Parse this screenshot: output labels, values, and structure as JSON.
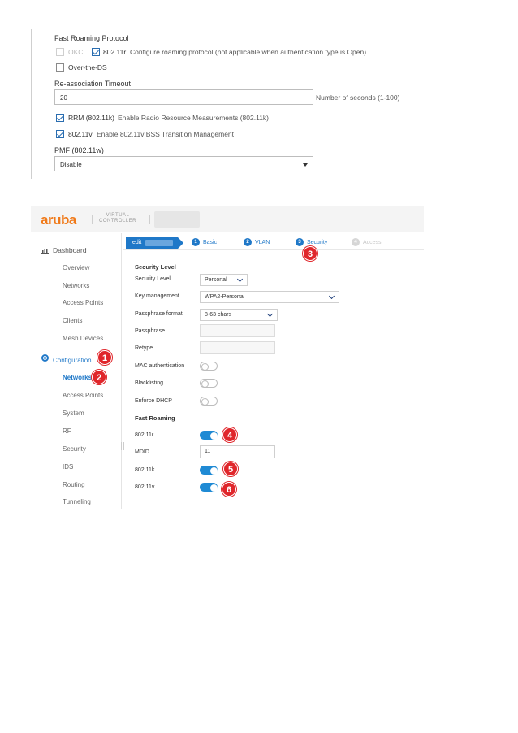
{
  "top_panel": {
    "fast_roaming_title": "Fast Roaming Protocol",
    "okc_label": "OKC",
    "r802_11r_label": "802.11r",
    "r802_11r_desc": "Configure roaming protocol (not applicable when authentication type is Open)",
    "over_the_ds_label": "Over-the-DS",
    "reassoc_title": "Re-association Timeout",
    "reassoc_value": "20",
    "reassoc_hint": "Number of seconds (1-100)",
    "rrm_label": "RRM (802.11k)",
    "rrm_desc": "Enable Radio Resource Measurements (802.11k)",
    "v802_11v_label": "802.11v",
    "v802_11v_desc": "Enable 802.11v BSS Transition Management",
    "pmf_title": "PMF (802.11w)",
    "pmf_value": "Disable"
  },
  "header": {
    "logo": "aruba",
    "product_line1": "VIRTUAL",
    "product_line2": "CONTROLLER"
  },
  "sidebar": {
    "dashboard": "Dashboard",
    "dashboard_items": [
      "Overview",
      "Networks",
      "Access Points",
      "Clients",
      "Mesh Devices"
    ],
    "configuration": "Configuration",
    "configuration_items": [
      "Networks",
      "Access Points",
      "System",
      "RF",
      "Security",
      "IDS",
      "Routing",
      "Tunneling"
    ]
  },
  "wizard": {
    "edit_label": "edit",
    "steps": [
      {
        "num": "1",
        "label": "Basic"
      },
      {
        "num": "2",
        "label": "VLAN"
      },
      {
        "num": "3",
        "label": "Security"
      },
      {
        "num": "4",
        "label": "Access"
      }
    ]
  },
  "form": {
    "security_level_head": "Security Level",
    "security_level_label": "Security Level",
    "security_level_value": "Personal",
    "key_mgmt_label": "Key management",
    "key_mgmt_value": "WPA2-Personal",
    "passphrase_format_label": "Passphrase format",
    "passphrase_format_value": "8-63 chars",
    "passphrase_label": "Passphrase",
    "retype_label": "Retype",
    "mac_auth_label": "MAC authentication",
    "blacklisting_label": "Blacklisting",
    "enforce_dhcp_label": "Enforce DHCP",
    "fast_roaming_head": "Fast Roaming",
    "r802_11r_label": "802.11r",
    "mdid_label": "MDID",
    "mdid_value": "11",
    "k802_11k_label": "802.11k",
    "v802_11v_label": "802.11v"
  },
  "badges": [
    "1",
    "2",
    "3",
    "4",
    "5",
    "6"
  ],
  "colors": {
    "accent": "#1f78c8",
    "badge": "#e0262b",
    "logo": "#f07a1a"
  }
}
